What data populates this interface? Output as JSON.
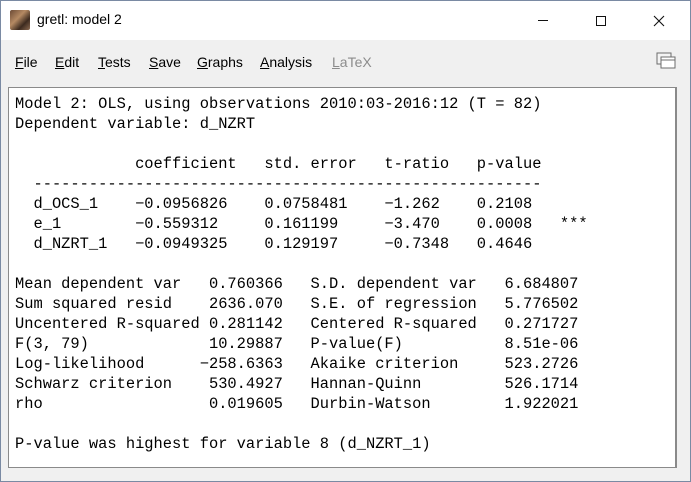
{
  "window": {
    "title": "gretl: model 2",
    "app_icon": "gretl-app-icon"
  },
  "menubar": {
    "items": [
      {
        "label": "File",
        "mnemonic": "F",
        "rest": "ile",
        "enabled": true
      },
      {
        "label": "Edit",
        "mnemonic": "E",
        "rest": "dit",
        "enabled": true
      },
      {
        "label": "Tests",
        "mnemonic": "T",
        "rest": "ests",
        "enabled": true
      },
      {
        "label": "Save",
        "mnemonic": "S",
        "rest": "ave",
        "enabled": true
      },
      {
        "label": "Graphs",
        "mnemonic": "G",
        "rest": "raphs",
        "enabled": true
      },
      {
        "label": "Analysis",
        "mnemonic": "A",
        "rest": "nalysis",
        "enabled": true
      },
      {
        "label": "LaTeX",
        "mnemonic": "L",
        "rest": "aTeX",
        "enabled": false
      }
    ]
  },
  "output": {
    "lines": [
      "Model 2: OLS, using observations 2010:03-2016:12 (T = 82)",
      "Dependent variable: d_NZRT",
      "",
      "             coefficient   std. error   t-ratio   p-value",
      "  -------------------------------------------------------",
      "  d_OCS_1    −0.0956826    0.0758481    −1.262    0.2108",
      "  e_1        −0.559312     0.161199     −3.470    0.0008   ***",
      "  d_NZRT_1   −0.0949325    0.129197     −0.7348   0.4646",
      "",
      "Mean dependent var   0.760366   S.D. dependent var   6.684807",
      "Sum squared resid    2636.070   S.E. of regression   5.776502",
      "Uncentered R-squared 0.281142   Centered R-squared   0.271727",
      "F(3, 79)             10.29887   P-value(F)           8.51e-06",
      "Log-likelihood      −258.6363   Akaike criterion     523.2726",
      "Schwarz criterion    530.4927   Hannan-Quinn         526.1714",
      "rho                  0.019605   Durbin-Watson        1.922021",
      "",
      "P-value was highest for variable 8 (d_NZRT_1)"
    ]
  }
}
